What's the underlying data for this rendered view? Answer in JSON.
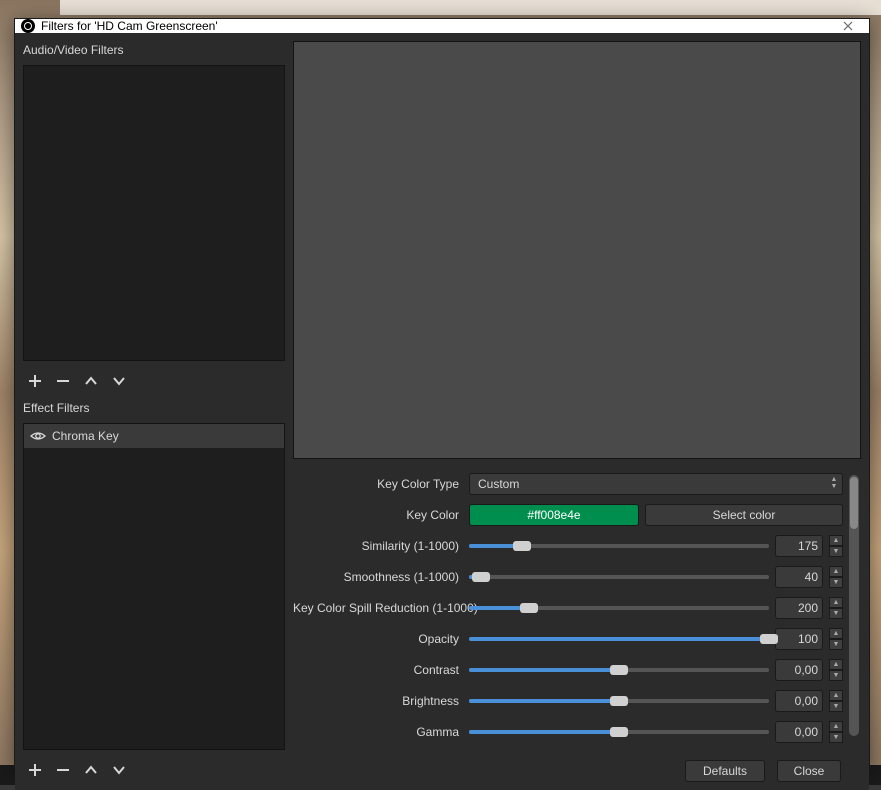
{
  "window": {
    "title": "Filters for 'HD Cam Greenscreen'"
  },
  "sections": {
    "audio_label": "Audio/Video Filters",
    "effect_label": "Effect Filters"
  },
  "effect_filters": [
    {
      "name": "Chroma Key",
      "visible": true
    }
  ],
  "props": {
    "key_color_type": {
      "label": "Key Color Type",
      "value": "Custom"
    },
    "key_color": {
      "label": "Key Color",
      "hex": "#ff008e4e",
      "select_label": "Select color"
    },
    "similarity": {
      "label": "Similarity (1-1000)",
      "value": 175,
      "min": 1,
      "max": 1000
    },
    "smoothness": {
      "label": "Smoothness (1-1000)",
      "value": 40,
      "min": 1,
      "max": 1000
    },
    "spill": {
      "label": "Key Color Spill Reduction (1-1000)",
      "value": 200,
      "min": 1,
      "max": 1000
    },
    "opacity": {
      "label": "Opacity",
      "value": 100,
      "min": 0,
      "max": 100
    },
    "contrast": {
      "label": "Contrast",
      "value": "0,00",
      "fill_pct": 50
    },
    "brightness": {
      "label": "Brightness",
      "value": "0,00",
      "fill_pct": 50
    },
    "gamma": {
      "label": "Gamma",
      "value": "0,00",
      "fill_pct": 50
    }
  },
  "buttons": {
    "defaults": "Defaults",
    "close": "Close"
  }
}
